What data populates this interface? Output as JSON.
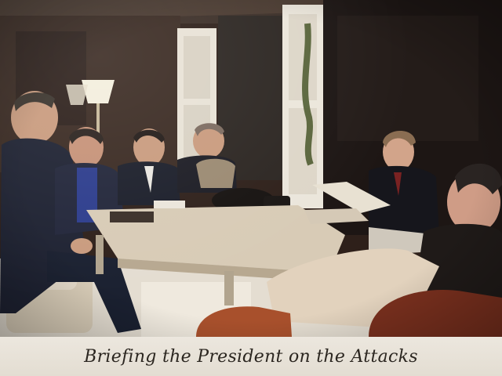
{
  "caption": {
    "text": "Briefing the President on the Attacks"
  },
  "photo": {
    "subject": "meeting-photograph",
    "colors": {
      "wall": "#3a2a22",
      "door": "#e8e2d6",
      "table": "#d8cbb6",
      "sofa": "#d9cdb8",
      "chair": "#a8502c",
      "suit": "#1e2232"
    }
  }
}
